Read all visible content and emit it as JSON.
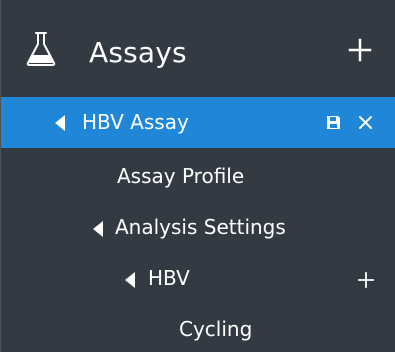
{
  "colors": {
    "background": "#333a42",
    "selected": "#1f86d8",
    "text": "#ffffff"
  },
  "header": {
    "title": "Assays",
    "icon": "flask-icon",
    "action_icon": "plus-icon"
  },
  "tree": {
    "items": [
      {
        "label": "HBV Assay",
        "expanded": true,
        "selected": true
      },
      {
        "label": "Assay Profile"
      },
      {
        "label": "Analysis Settings",
        "expanded": true
      },
      {
        "label": "HBV",
        "expanded": true
      },
      {
        "label": "Cycling"
      }
    ]
  }
}
